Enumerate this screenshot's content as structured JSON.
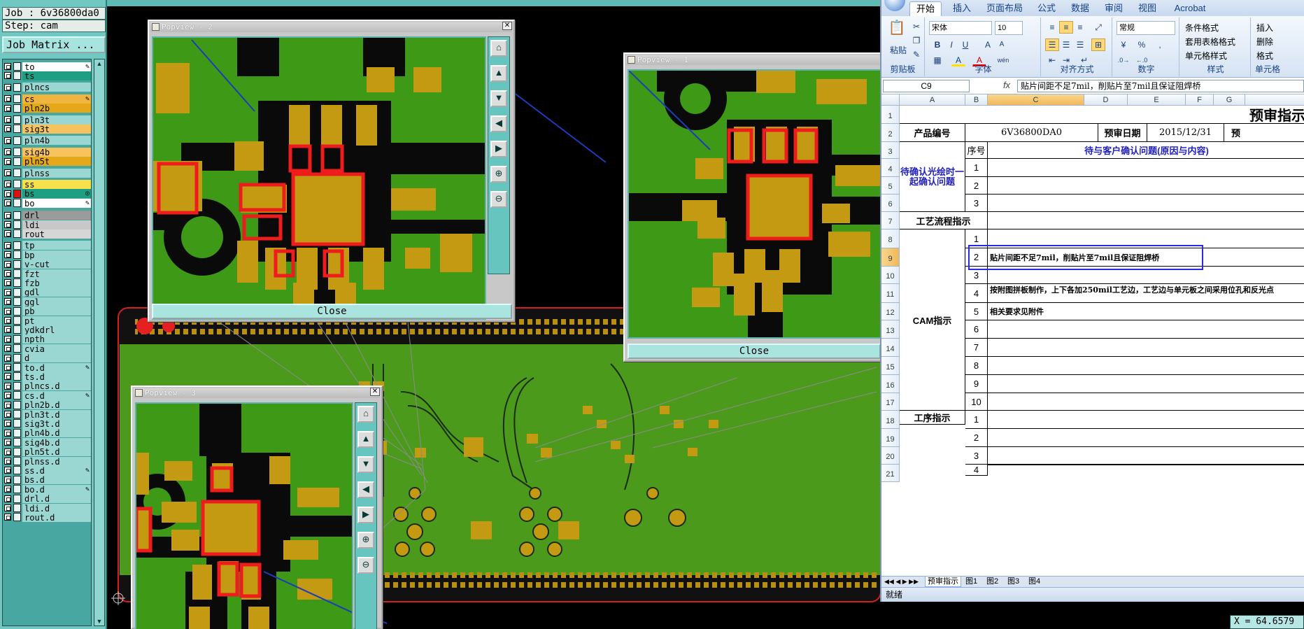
{
  "cam": {
    "job_label": "Job : 6v36800da0",
    "step_label": "Step: cam",
    "job_matrix_button": "Job Matrix ...",
    "layers": [
      {
        "name": "to",
        "sw": "#ffffff",
        "bg": "#ffffff",
        "mark": "✎"
      },
      {
        "name": "ts",
        "sw": "#1e9f83",
        "bg": "#1e9f83",
        "mark": ""
      },
      {
        "name": "plncs",
        "sw": "#9ad6d2",
        "bg": "#9ad6d2",
        "mark": ""
      },
      {
        "name": "cs",
        "sw": "#f0b440",
        "bg": "#f0b440",
        "mark": "✎"
      },
      {
        "name": "pln2b",
        "sw": "#e4a81a",
        "bg": "#e4a81a",
        "mark": ""
      },
      {
        "name": "pln3t",
        "sw": "#9ad6d2",
        "bg": "#9ad6d2",
        "mark": ""
      },
      {
        "name": "sig3t",
        "sw": "#f7c35e",
        "bg": "#f7c35e",
        "mark": ""
      },
      {
        "name": "pln4b",
        "sw": "#9ad6d2",
        "bg": "#9ad6d2",
        "mark": ""
      },
      {
        "name": "sig4b",
        "sw": "#f7c35e",
        "bg": "#f7c35e",
        "mark": ""
      },
      {
        "name": "pln5t",
        "sw": "#e4a81a",
        "bg": "#e4a81a",
        "mark": ""
      },
      {
        "name": "plnss",
        "sw": "#9ad6d2",
        "bg": "#9ad6d2",
        "mark": ""
      },
      {
        "name": "ss",
        "sw": "#f7e04a",
        "bg": "#f7e04a",
        "mark": ""
      },
      {
        "name": "bs",
        "sw": "#e01010",
        "bg": "#1e9f83",
        "mark": "◎"
      },
      {
        "name": "bo",
        "sw": "#ffffff",
        "bg": "#ffffff",
        "mark": "✎"
      },
      {
        "name": "drl",
        "sw": "#9b9b9b",
        "bg": "#9b9b9b",
        "mark": ""
      },
      {
        "name": "ldi",
        "sw": "#c8c8c8",
        "bg": "#c8c8c8",
        "mark": ""
      },
      {
        "name": "rout",
        "sw": "#d6d6d6",
        "bg": "#d6d6d6",
        "mark": ""
      },
      {
        "name": "tp",
        "sw": "#9ad6d2",
        "bg": "#9ad6d2",
        "mark": ""
      },
      {
        "name": "bp",
        "sw": "#9ad6d2",
        "bg": "#9ad6d2",
        "mark": ""
      },
      {
        "name": "v-cut",
        "sw": "#9ad6d2",
        "bg": "#9ad6d2",
        "mark": ""
      },
      {
        "name": "fzt",
        "sw": "#9ad6d2",
        "bg": "#9ad6d2",
        "mark": ""
      },
      {
        "name": "fzb",
        "sw": "#9ad6d2",
        "bg": "#9ad6d2",
        "mark": ""
      },
      {
        "name": "gdl",
        "sw": "#9ad6d2",
        "bg": "#9ad6d2",
        "mark": ""
      },
      {
        "name": "ggl",
        "sw": "#9ad6d2",
        "bg": "#9ad6d2",
        "mark": ""
      },
      {
        "name": "pb",
        "sw": "#9ad6d2",
        "bg": "#9ad6d2",
        "mark": ""
      },
      {
        "name": "pt",
        "sw": "#9ad6d2",
        "bg": "#9ad6d2",
        "mark": ""
      },
      {
        "name": "ydkdrl",
        "sw": "#9ad6d2",
        "bg": "#9ad6d2",
        "mark": ""
      },
      {
        "name": "npth",
        "sw": "#9ad6d2",
        "bg": "#9ad6d2",
        "mark": ""
      },
      {
        "name": "cvia",
        "sw": "#9ad6d2",
        "bg": "#9ad6d2",
        "mark": ""
      },
      {
        "name": "d",
        "sw": "#9ad6d2",
        "bg": "#9ad6d2",
        "mark": ""
      },
      {
        "name": "to.d",
        "sw": "#9ad6d2",
        "bg": "#9ad6d2",
        "mark": "✎"
      },
      {
        "name": "ts.d",
        "sw": "#9ad6d2",
        "bg": "#9ad6d2",
        "mark": ""
      },
      {
        "name": "plncs.d",
        "sw": "#9ad6d2",
        "bg": "#9ad6d2",
        "mark": ""
      },
      {
        "name": "cs.d",
        "sw": "#9ad6d2",
        "bg": "#9ad6d2",
        "mark": "✎"
      },
      {
        "name": "pln2b.d",
        "sw": "#9ad6d2",
        "bg": "#9ad6d2",
        "mark": ""
      },
      {
        "name": "pln3t.d",
        "sw": "#9ad6d2",
        "bg": "#9ad6d2",
        "mark": ""
      },
      {
        "name": "sig3t.d",
        "sw": "#9ad6d2",
        "bg": "#9ad6d2",
        "mark": ""
      },
      {
        "name": "pln4b.d",
        "sw": "#9ad6d2",
        "bg": "#9ad6d2",
        "mark": ""
      },
      {
        "name": "sig4b.d",
        "sw": "#9ad6d2",
        "bg": "#9ad6d2",
        "mark": ""
      },
      {
        "name": "pln5t.d",
        "sw": "#9ad6d2",
        "bg": "#9ad6d2",
        "mark": ""
      },
      {
        "name": "plnss.d",
        "sw": "#9ad6d2",
        "bg": "#9ad6d2",
        "mark": ""
      },
      {
        "name": "ss.d",
        "sw": "#9ad6d2",
        "bg": "#9ad6d2",
        "mark": "✎"
      },
      {
        "name": "bs.d",
        "sw": "#9ad6d2",
        "bg": "#9ad6d2",
        "mark": ""
      },
      {
        "name": "bo.d",
        "sw": "#9ad6d2",
        "bg": "#9ad6d2",
        "mark": "✎"
      },
      {
        "name": "drl.d",
        "sw": "#9ad6d2",
        "bg": "#9ad6d2",
        "mark": ""
      },
      {
        "name": "ldi.d",
        "sw": "#9ad6d2",
        "bg": "#9ad6d2",
        "mark": ""
      },
      {
        "name": "rout.d",
        "sw": "#9ad6d2",
        "bg": "#9ad6d2",
        "mark": ""
      }
    ],
    "popviews": [
      {
        "title": "Popview - 2",
        "close": "Close"
      },
      {
        "title": "Popview - 1",
        "close": "Close"
      },
      {
        "title": "Popview - 3",
        "close": "Close"
      }
    ],
    "coord_readout": "X = 64.6579",
    "colors": {
      "copper": "#3e9a16",
      "pad": "#c39a12",
      "mask_open": "#ee1c1c",
      "panel": "#71c7c2"
    }
  },
  "excel": {
    "tabs": [
      "开始",
      "插入",
      "页面布局",
      "公式",
      "数据",
      "审阅",
      "视图",
      "Acrobat"
    ],
    "active_tab": "开始",
    "clipboard": {
      "paste": "粘贴",
      "label": "剪贴板"
    },
    "font": {
      "name": "宋体",
      "size": "10",
      "label": "字体",
      "bold": "B",
      "italic": "I",
      "underline": "U",
      "grow": "A",
      "shrink": "A",
      "fill": "A",
      "color": "A",
      "phonetic": "wén"
    },
    "alignment": {
      "label": "对齐方式"
    },
    "number": {
      "format": "常规",
      "label": "数字",
      "percent": "%",
      "comma": ","
    },
    "styles": {
      "label": "样式",
      "cond": "条件格式",
      "table": "套用表格格式",
      "cell": "单元格样式"
    },
    "cells_group": {
      "label": "单元格",
      "insert": "插入",
      "delete": "删除",
      "format": "格式"
    },
    "namebox": "C9",
    "formula": "贴片间距不足7mil，削贴片至7mil且保证阻焊桥",
    "columns": [
      "A",
      "B",
      "C",
      "D",
      "E",
      "F",
      "G"
    ],
    "rows": [
      "1",
      "2",
      "3",
      "4",
      "5",
      "6",
      "7",
      "8",
      "9",
      "10",
      "11",
      "12",
      "13",
      "14",
      "15",
      "16",
      "17",
      "18",
      "19",
      "20",
      "21"
    ],
    "title": "预审指示",
    "product_label": "产品编号",
    "product_value": "6V36800DA0",
    "date_label": "预审日期",
    "date_value": "2015/12/31",
    "extra_label": "预",
    "seq_label": "序号",
    "pending_header": "待与客户确认问题(原因与内容)",
    "pending_label": "待确认光绘时一起确认问题",
    "pending_nums": [
      "1",
      "2",
      "3"
    ],
    "process_label": "工艺流程指示",
    "cam_label": "CAM指示",
    "cam_nums": [
      "1",
      "2",
      "3",
      "4",
      "5",
      "6",
      "7",
      "8",
      "9",
      "10"
    ],
    "cam_notes": [
      "",
      "贴片间距不足7mil，削贴片至7mil且保证阻焊桥",
      "",
      "按附图拼板制作，上下各加250mil工艺边，工艺边与单元板之间采用位孔和反光点",
      "相关要求见附件",
      "",
      "",
      "",
      "",
      ""
    ],
    "proc_label": "工序指示",
    "proc_nums": [
      "1",
      "2",
      "3",
      "4"
    ],
    "sheet_tabs": [
      "预审指示",
      "图1",
      "图2",
      "图3",
      "图4"
    ],
    "status": "就绪"
  }
}
